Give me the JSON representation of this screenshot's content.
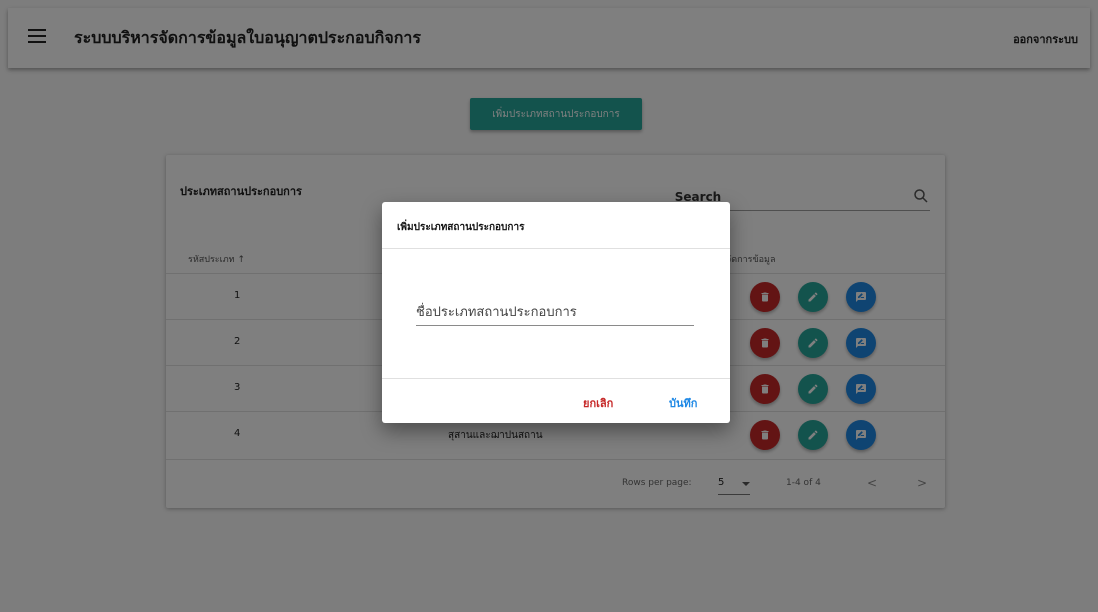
{
  "header": {
    "title": "ระบบบริหารจัดการข้อมูลใบอนุญาตประกอบกิจการ",
    "logout_label": "ออกจากระบบ",
    "menu_icon": "menu-icon"
  },
  "toolbar": {
    "add_button_label": "เพิ่มประเภทสถานประกอบการ"
  },
  "table": {
    "title": "ประเภทสถานประกอบการ",
    "search_placeholder": "Search",
    "columns": [
      "รหัสประเภท",
      "จัดการข้อมูล"
    ],
    "sort_icon": "↑",
    "rows": [
      {
        "code": "1",
        "name": ""
      },
      {
        "code": "2",
        "name": ""
      },
      {
        "code": "3",
        "name": ""
      },
      {
        "code": "4",
        "name": "สุสานและฌาปนสถาน"
      }
    ],
    "action_colors": {
      "delete": "#c62828",
      "edit": "#26a69a",
      "view": "#1e88e5"
    },
    "footer": {
      "rows_per_page_label": "Rows per page:",
      "rows_per_page_value": "5",
      "range_text": "1-4 of 4",
      "prev": "<",
      "next": ">"
    }
  },
  "dialog": {
    "title": "เพิ่มประเภทสถานประกอบการ",
    "input_placeholder": "ชื่อประเภทสถานประกอบการ",
    "cancel_label": "ยกเลิก",
    "save_label": "บันทึก"
  }
}
